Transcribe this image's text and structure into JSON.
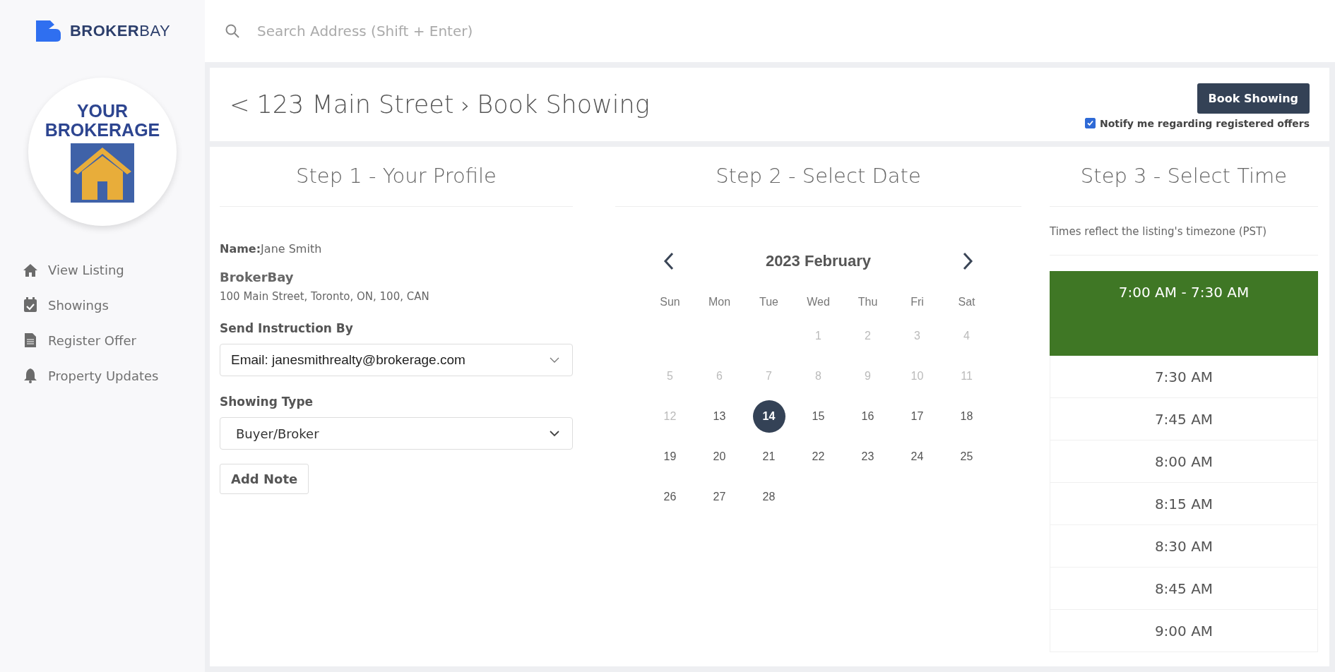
{
  "brand": {
    "name_bold": "BROKER",
    "name_light": "BAY"
  },
  "brokerage_logo": {
    "line1": "YOUR",
    "line2": "BROKERAGE"
  },
  "sidebar": {
    "items": [
      {
        "label": "View Listing",
        "kind": "home"
      },
      {
        "label": "Showings",
        "kind": "calendar"
      },
      {
        "label": "Register Offer",
        "kind": "document"
      },
      {
        "label": "Property Updates",
        "kind": "bell"
      }
    ]
  },
  "search": {
    "placeholder": "Search Address (Shift + Enter)"
  },
  "header": {
    "back": "<",
    "address": "123 Main Street",
    "separator": "›",
    "page": "Book Showing",
    "button": "Book Showing",
    "notify": {
      "label": "Notify me regarding registered offers",
      "checked": true
    }
  },
  "steps": [
    "Step 1 - Your Profile",
    "Step 2 - Select Date",
    "Step 3 - Select Time"
  ],
  "profile": {
    "name_label": "Name:",
    "name": "Jane Smith",
    "company": "BrokerBay",
    "address": "100 Main Street, Toronto, ON, 100, CAN",
    "instruction_label": "Send Instruction By",
    "instruction_value": "Email: janesmithrealty@brokerage.com",
    "type_label": "Showing Type",
    "type_value": "Buyer/Broker",
    "add_note": "Add Note"
  },
  "calendar": {
    "title": "2023 February",
    "weekdays": [
      "Sun",
      "Mon",
      "Tue",
      "Wed",
      "Thu",
      "Fri",
      "Sat"
    ],
    "weeks": [
      [
        {
          "day": "1",
          "disabled": true,
          "selected": false
        },
        {
          "day": "2",
          "disabled": true,
          "selected": false
        },
        {
          "day": "3",
          "disabled": true,
          "selected": false
        },
        {
          "day": "4",
          "disabled": true,
          "selected": false
        }
      ],
      [
        {
          "day": "5",
          "disabled": true,
          "selected": false
        },
        {
          "day": "6",
          "disabled": true,
          "selected": false
        },
        {
          "day": "7",
          "disabled": true,
          "selected": false
        },
        {
          "day": "8",
          "disabled": true,
          "selected": false
        },
        {
          "day": "9",
          "disabled": true,
          "selected": false
        },
        {
          "day": "10",
          "disabled": true,
          "selected": false
        },
        {
          "day": "11",
          "disabled": true,
          "selected": false
        }
      ],
      [
        {
          "day": "12",
          "disabled": true,
          "selected": false
        },
        {
          "day": "13",
          "disabled": false,
          "selected": false
        },
        {
          "day": "14",
          "disabled": false,
          "selected": true
        },
        {
          "day": "15",
          "disabled": false,
          "selected": false
        },
        {
          "day": "16",
          "disabled": false,
          "selected": false
        },
        {
          "day": "17",
          "disabled": false,
          "selected": false
        },
        {
          "day": "18",
          "disabled": false,
          "selected": false
        }
      ],
      [
        {
          "day": "19",
          "disabled": false,
          "selected": false
        },
        {
          "day": "20",
          "disabled": false,
          "selected": false
        },
        {
          "day": "21",
          "disabled": false,
          "selected": false
        },
        {
          "day": "22",
          "disabled": false,
          "selected": false
        },
        {
          "day": "23",
          "disabled": false,
          "selected": false
        },
        {
          "day": "24",
          "disabled": false,
          "selected": false
        },
        {
          "day": "25",
          "disabled": false,
          "selected": false
        }
      ],
      [
        {
          "day": "26",
          "disabled": false,
          "selected": false
        },
        {
          "day": "27",
          "disabled": false,
          "selected": false
        },
        {
          "day": "28",
          "disabled": false,
          "selected": false
        }
      ]
    ]
  },
  "times": {
    "note": "Times reflect the listing's timezone (PST)",
    "slots": [
      {
        "label": "7:00 AM - 7:30 AM",
        "selected": true
      },
      {
        "label": "7:30 AM",
        "selected": false
      },
      {
        "label": "7:45 AM",
        "selected": false
      },
      {
        "label": "8:00 AM",
        "selected": false
      },
      {
        "label": "8:15 AM",
        "selected": false
      },
      {
        "label": "8:30 AM",
        "selected": false
      },
      {
        "label": "8:45 AM",
        "selected": false
      },
      {
        "label": "9:00 AM",
        "selected": false
      }
    ]
  }
}
